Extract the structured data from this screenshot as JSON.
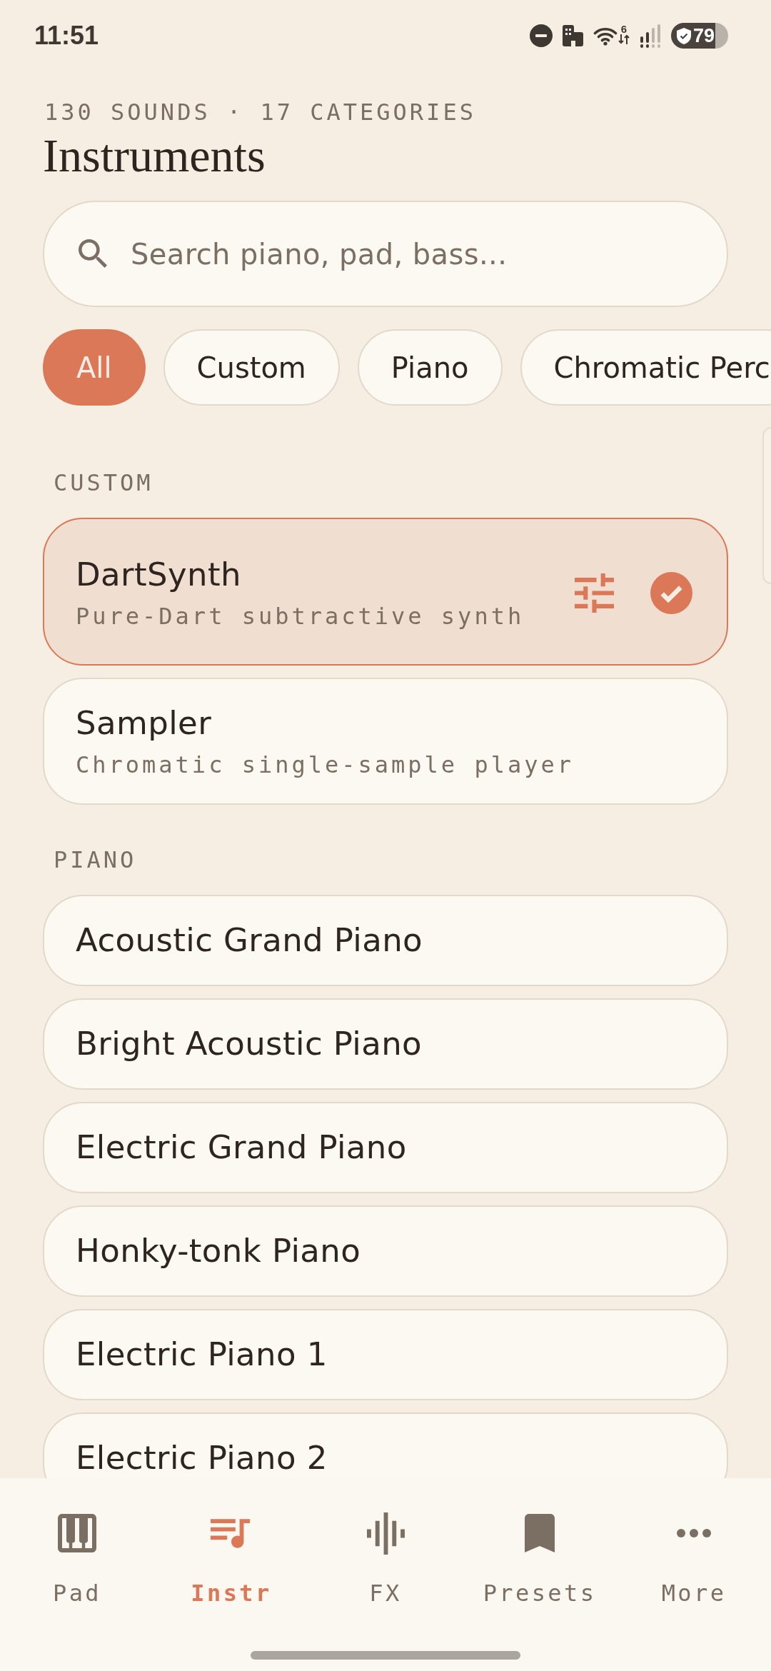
{
  "status_bar": {
    "time": "11:51",
    "wifi_badge": "6",
    "battery": "79"
  },
  "header": {
    "overline": "130 SOUNDS · 17 CATEGORIES",
    "title": "Instruments"
  },
  "search": {
    "placeholder": "Search piano, pad, bass..."
  },
  "filter_chips": [
    {
      "label": "All",
      "selected": true
    },
    {
      "label": "Custom",
      "selected": false
    },
    {
      "label": "Piano",
      "selected": false
    },
    {
      "label": "Chromatic Perc",
      "selected": false
    }
  ],
  "sections": [
    {
      "heading": "CUSTOM",
      "items": [
        {
          "name": "DartSynth",
          "description": "Pure-Dart subtractive synth",
          "selected": true,
          "adjustable": true
        },
        {
          "name": "Sampler",
          "description": "Chromatic single-sample player",
          "selected": false,
          "adjustable": false
        }
      ]
    },
    {
      "heading": "PIANO",
      "items": [
        {
          "name": "Acoustic Grand Piano",
          "selected": false,
          "adjustable": false
        },
        {
          "name": "Bright Acoustic Piano",
          "selected": false,
          "adjustable": false
        },
        {
          "name": "Electric Grand Piano",
          "selected": false,
          "adjustable": false
        },
        {
          "name": "Honky-tonk Piano",
          "selected": false,
          "adjustable": false
        },
        {
          "name": "Electric Piano 1",
          "selected": false,
          "adjustable": false
        },
        {
          "name": "Electric Piano 2",
          "selected": false,
          "adjustable": false
        }
      ]
    }
  ],
  "bottom_nav": [
    {
      "label": "Pad",
      "selected": false
    },
    {
      "label": "Instr",
      "selected": true
    },
    {
      "label": "FX",
      "selected": false
    },
    {
      "label": "Presets",
      "selected": false
    },
    {
      "label": "More",
      "selected": false
    }
  ]
}
